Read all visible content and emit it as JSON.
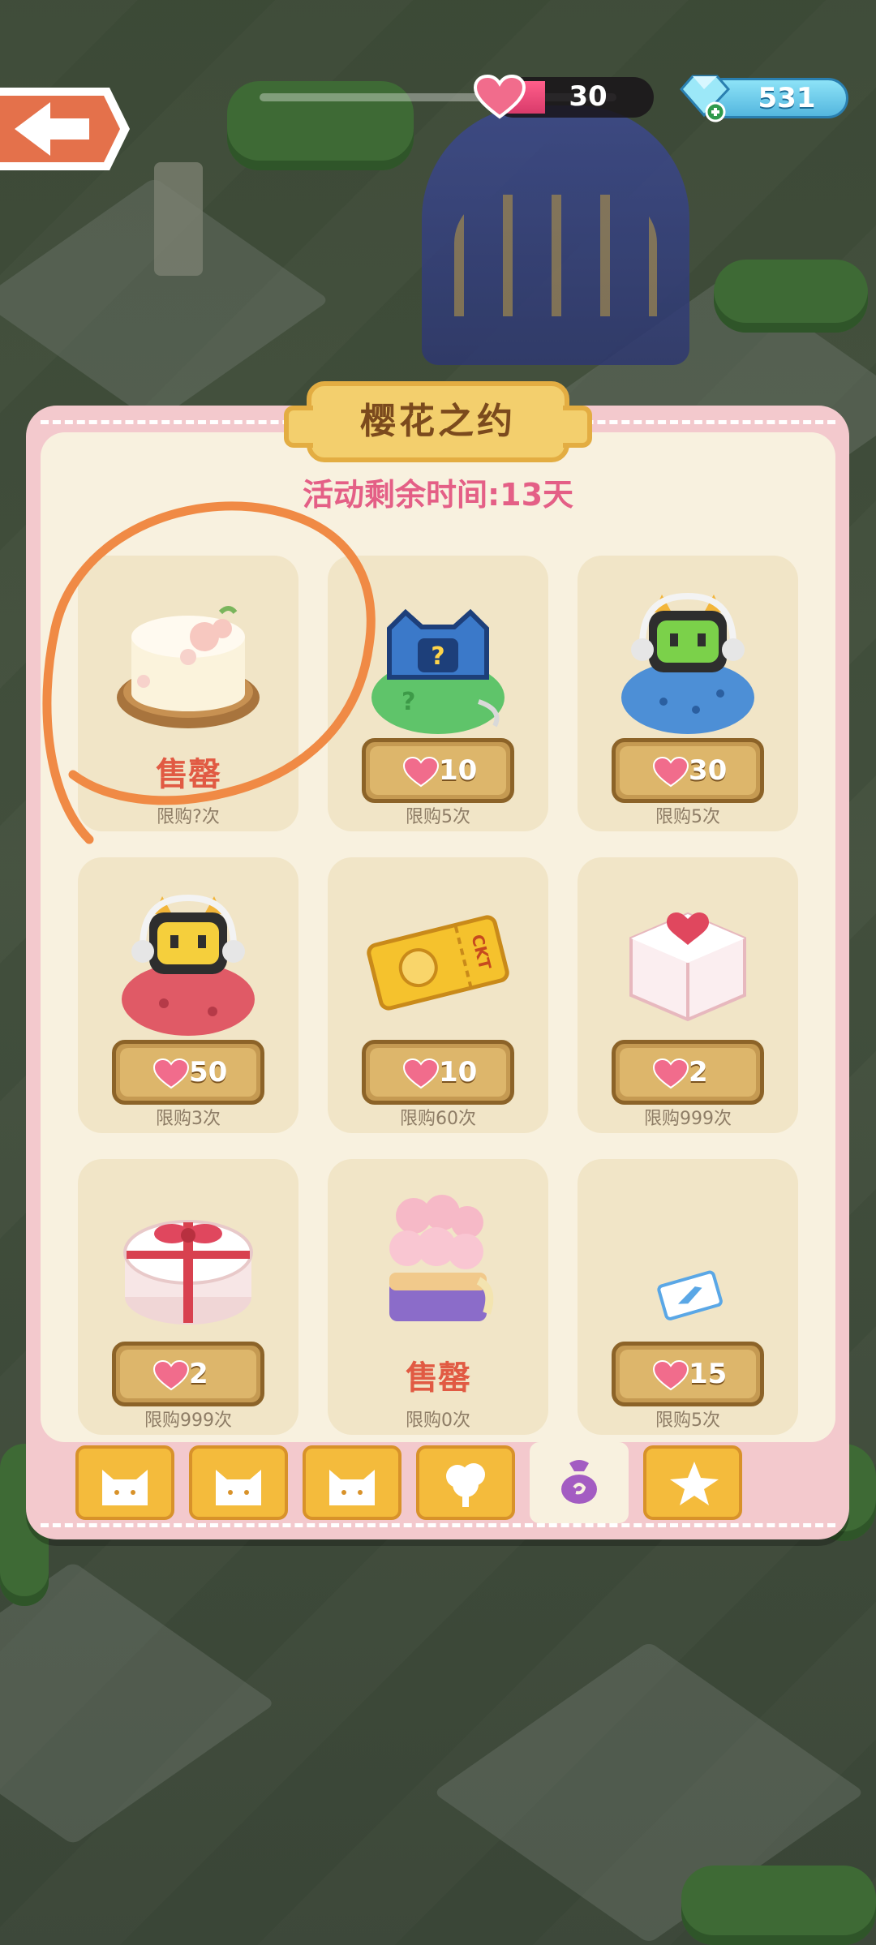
{
  "hud": {
    "hearts": "30",
    "gems": "531"
  },
  "event": {
    "title": "樱花之约",
    "remaining": "活动剩余时间:13天"
  },
  "items": [
    {
      "name": "cake",
      "price": "",
      "sold_label": "售罄",
      "limit": "限购?次"
    },
    {
      "name": "blue-mystery-bag",
      "price": "10",
      "sold_label": "",
      "limit": "限购5次"
    },
    {
      "name": "green-robot-bag",
      "price": "30",
      "sold_label": "",
      "limit": "限购5次"
    },
    {
      "name": "yellow-robot-bag",
      "price": "50",
      "sold_label": "",
      "limit": "限购3次"
    },
    {
      "name": "ticket",
      "price": "10",
      "sold_label": "",
      "limit": "限购60次"
    },
    {
      "name": "heart-cake",
      "price": "2",
      "sold_label": "",
      "limit": "限购999次"
    },
    {
      "name": "gift-box",
      "price": "2",
      "sold_label": "",
      "limit": "限购999次"
    },
    {
      "name": "pastry-bundle",
      "price": "",
      "sold_label": "售罄",
      "limit": "限购0次"
    },
    {
      "name": "small-ticket",
      "price": "15",
      "sold_label": "",
      "limit": "限购5次"
    }
  ],
  "tabs": [
    {
      "icon": "cat-face-icon",
      "active": false
    },
    {
      "icon": "cat-face-icon",
      "active": false
    },
    {
      "icon": "cat-face-icon",
      "active": false
    },
    {
      "icon": "tree-icon",
      "active": false
    },
    {
      "icon": "bag-icon",
      "active": true
    },
    {
      "icon": "star-icon",
      "active": false
    }
  ],
  "colors": {
    "panel_border": "#f3c9cd",
    "panel_bg": "#f8f1df",
    "price_button": "#ddb66b",
    "sold_text": "#e15a43",
    "timer_text": "#e45f86",
    "annotation": "#f08a45"
  }
}
